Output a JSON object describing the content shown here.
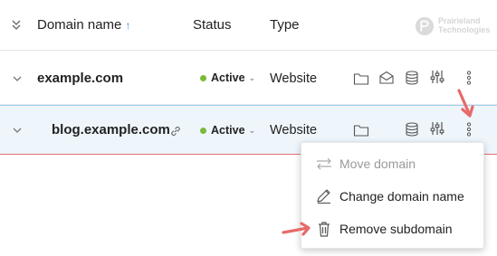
{
  "header": {
    "domain_col": "Domain name",
    "sort_indicator": "↑",
    "status_col": "Status",
    "type_col": "Type",
    "logo_text_line1": "Prairieland",
    "logo_text_line2": "Technologies"
  },
  "rows": [
    {
      "name": "example.com",
      "status": "Active",
      "type": "Website"
    },
    {
      "name": "blog.example.com",
      "status": "Active",
      "type": "Website"
    }
  ],
  "menu": {
    "items": [
      {
        "label": "Move domain",
        "icon": "move-icon",
        "enabled": false
      },
      {
        "label": "Change domain name",
        "icon": "pencil-icon",
        "enabled": true
      },
      {
        "label": "Remove subdomain",
        "icon": "trash-icon",
        "enabled": true
      }
    ]
  },
  "colors": {
    "active_dot": "#7bb93a",
    "sort_arrow": "#3a8dde",
    "selected_row_bg": "#eef6fc",
    "annotation_arrow": "#e86a6a"
  }
}
